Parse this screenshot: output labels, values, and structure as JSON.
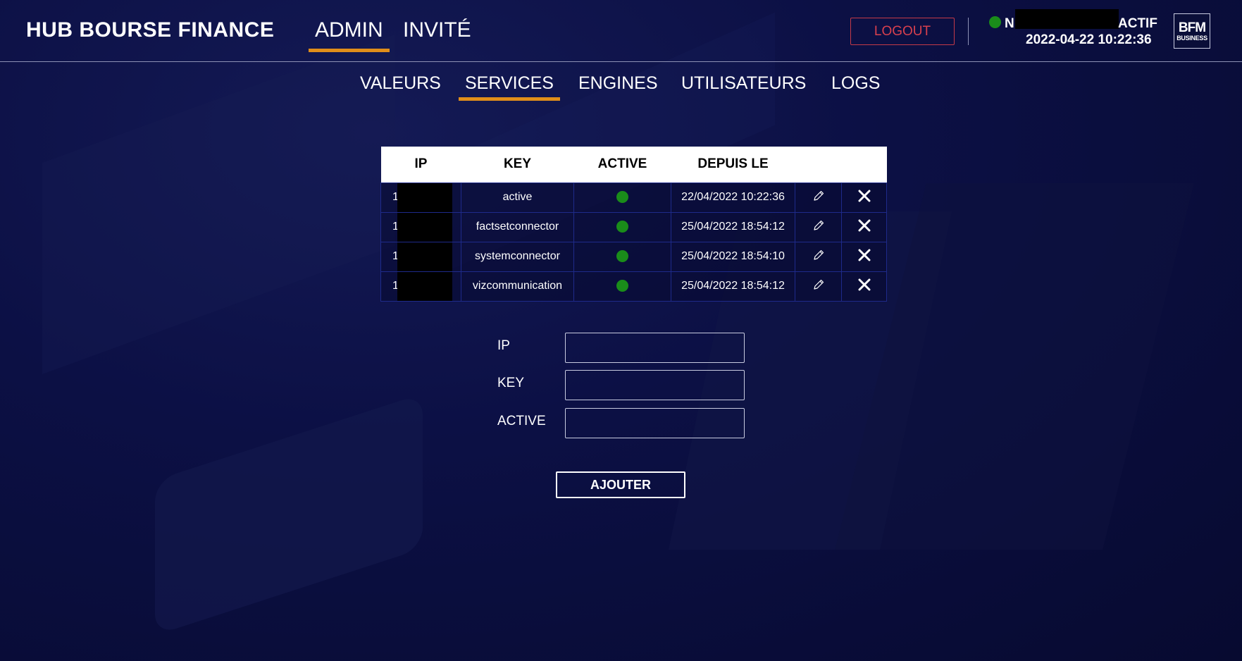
{
  "header": {
    "brand": "HUB BOURSE FINANCE",
    "tabs": [
      {
        "label": "ADMIN",
        "active": true
      },
      {
        "label": "INVITÉ",
        "active": false
      }
    ],
    "logout_label": "LOGOUT",
    "status": {
      "name_visible": "N",
      "state": "ACTIF",
      "datetime": "2022-04-22 10:22:36",
      "indicator_color": "#1a8c1a"
    },
    "logo": {
      "line1": "BFM",
      "line2": "BUSINESS"
    }
  },
  "subnav": {
    "tabs": [
      {
        "label": "VALEURS",
        "active": false
      },
      {
        "label": "SERVICES",
        "active": true
      },
      {
        "label": "ENGINES",
        "active": false
      },
      {
        "label": "UTILISATEURS",
        "active": false
      },
      {
        "label": "LOGS",
        "active": false
      }
    ]
  },
  "table": {
    "headers": [
      "IP",
      "KEY",
      "ACTIVE",
      "DEPUIS LE",
      "",
      ""
    ],
    "rows": [
      {
        "ip": "1",
        "key": "active",
        "active": true,
        "since": "22/04/2022 10:22:36"
      },
      {
        "ip": "1",
        "key": "factsetconnector",
        "active": true,
        "since": "25/04/2022 18:54:12"
      },
      {
        "ip": "1",
        "key": "systemconnector",
        "active": true,
        "since": "25/04/2022 18:54:10"
      },
      {
        "ip": "1",
        "key": "vizcommunication",
        "active": true,
        "since": "25/04/2022 18:54:12"
      }
    ],
    "row_icons": {
      "edit": "pencil-icon",
      "delete": "close-icon"
    }
  },
  "form": {
    "fields": [
      {
        "label": "IP",
        "value": ""
      },
      {
        "label": "KEY",
        "value": ""
      },
      {
        "label": "ACTIVE",
        "value": ""
      }
    ],
    "submit_label": "AJOUTER"
  },
  "colors": {
    "accent": "#e08e1a",
    "logout": "#d8404e",
    "active_dot": "#1a8c1a",
    "background": "#0b0f3c"
  }
}
